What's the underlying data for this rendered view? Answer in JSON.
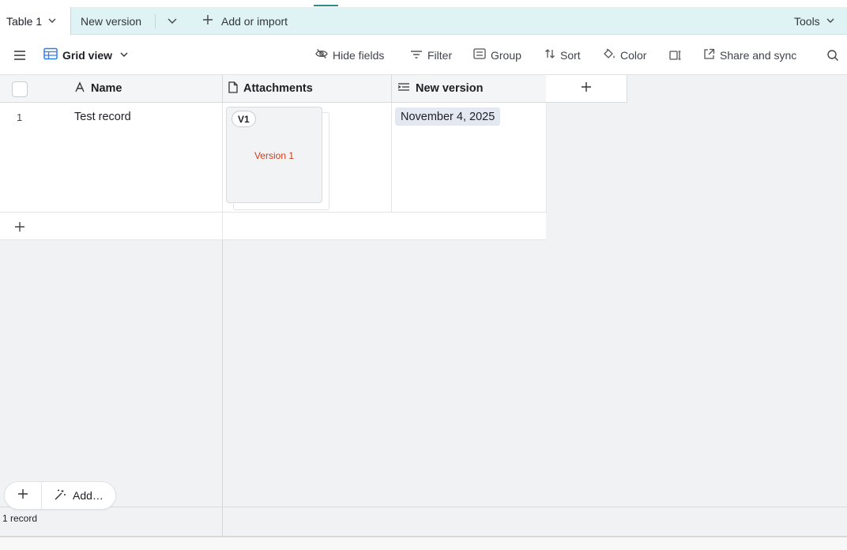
{
  "tabs": {
    "active_table": "Table 1",
    "second_table": "New version",
    "add_import": "Add or import",
    "tools": "Tools"
  },
  "toolbar": {
    "view_name": "Grid view",
    "hide_fields": "Hide fields",
    "filter": "Filter",
    "group": "Group",
    "sort": "Sort",
    "color": "Color",
    "share_sync": "Share and sync"
  },
  "columns": {
    "name": "Name",
    "attachments": "Attachments",
    "new_version": "New version"
  },
  "rows": [
    {
      "number": "1",
      "name": "Test record",
      "attachment_badge": "V1",
      "attachment_preview_text": "Version 1",
      "new_version_date": "November 4, 2025"
    }
  ],
  "footer": {
    "add_label": "Add…",
    "record_count": "1 record"
  },
  "icons": {
    "tab_chevron": "chevron-down-icon",
    "add": "plus-icon",
    "menu": "hamburger-icon",
    "grid": "grid-view-icon",
    "hide": "eye-off-icon",
    "filter": "filter-lines-icon",
    "group": "group-list-icon",
    "sort": "sort-arrows-icon",
    "color": "paint-bucket-icon",
    "row_height": "row-height-icon",
    "share": "external-share-icon",
    "search": "search-icon",
    "name_field": "text-a-icon",
    "attachment_field": "document-icon",
    "formula_field": "lines-icon",
    "ai": "magic-wand-icon"
  },
  "colors": {
    "tabs_bg": "#dff3f4",
    "accent": "#2a8f87",
    "grid_view_icon": "#2d7ff9",
    "date_pill": "#e3e8f1",
    "attachment_text": "#d23c1a"
  }
}
